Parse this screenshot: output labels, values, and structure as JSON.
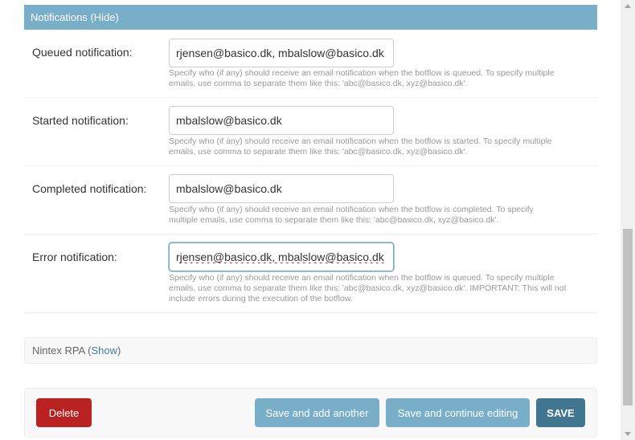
{
  "notifications": {
    "title": "Notifications",
    "toggle_label": "(Hide)",
    "fields": [
      {
        "label": "Queued notification:",
        "value": "rjensen@basico.dk, mbalslow@basico.dk",
        "help_lines": [
          "Specify who (if any) should receive an email notification when the botflow is queued. To specify multiple",
          "emails, use comma to separate them like this: 'abc@basico.dk, xyz@basico.dk'."
        ]
      },
      {
        "label": "Started notification:",
        "value": "mbalslow@basico.dk",
        "help_lines": [
          "Specify who (if any) should receive an email notification when the botflow is started. To specify multiple",
          "emails, use comma to separate them like this: 'abc@basico.dk, xyz@basico.dk'."
        ]
      },
      {
        "label": "Completed notification:",
        "value": "mbalslow@basico.dk",
        "help_lines": [
          "Specify who (if any) should receive an email notification when the botflow is completed. To specify",
          "multiple emails, use comma to separate them like this: 'abc@basico.dk, xyz@basico.dk'."
        ]
      },
      {
        "label": "Error notification:",
        "value": "rjensen@basico.dk, mbalslow@basico.dk",
        "help_lines": [
          "Specify who (if any) should receive an email notification when the botflow is queued. To specify multiple",
          "emails, use comma to separate them like this: 'abc@basico.dk, xyz@basico.dk'. IMPORTANT: This will not",
          "include errors during the execution of the botflow."
        ]
      }
    ]
  },
  "nintex": {
    "title": "Nintex RPA",
    "open_paren": "(",
    "show_label": "Show",
    "close_paren": ")"
  },
  "submit": {
    "delete_label": "Delete",
    "save_add_label": "Save and add another",
    "save_continue_label": "Save and continue editing",
    "save_label": "SAVE"
  },
  "colors": {
    "header_bg": "#79aec8",
    "delete_bg": "#ba2121",
    "secondary_bg": "#79aec8",
    "save_bg": "#417690",
    "link": "#447e9b"
  }
}
